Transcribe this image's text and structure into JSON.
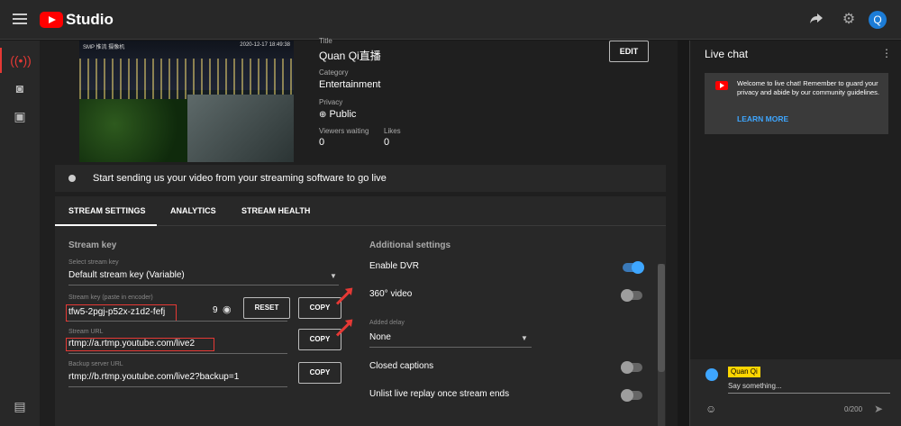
{
  "app": {
    "title": "Studio"
  },
  "header": {
    "avatar_letter": "Q",
    "share_icon": "share-icon",
    "settings_icon": "gear-icon"
  },
  "nav": {
    "items": [
      {
        "name": "live-icon",
        "glyph": "((•))"
      },
      {
        "name": "camera-icon",
        "glyph": "◙"
      },
      {
        "name": "calendar-icon",
        "glyph": "▣"
      },
      {
        "name": "feedback-icon",
        "glyph": "▤"
      }
    ]
  },
  "stream": {
    "thumb_stamp_left": "SMP 推流 摄像机",
    "thumb_stamp_right": "2020-12-17 18:49:38",
    "title_label": "Title",
    "title": "Quan Qi直播",
    "category_label": "Category",
    "category": "Entertainment",
    "privacy_label": "Privacy",
    "privacy": "Public",
    "viewers_label": "Viewers waiting",
    "viewers": "0",
    "likes_label": "Likes",
    "likes": "0",
    "edit_label": "EDIT",
    "status_text": "Start sending us your video from your streaming software to go live"
  },
  "tabs": [
    {
      "label": "STREAM SETTINGS",
      "active": true
    },
    {
      "label": "ANALYTICS",
      "active": false
    },
    {
      "label": "STREAM HEALTH",
      "active": false
    }
  ],
  "settings": {
    "stream_key_title": "Stream key",
    "select_key_label": "Select stream key",
    "select_key_value": "Default stream key (Variable)",
    "key_label": "Stream key (paste in encoder)",
    "key_value": "tfw5-2pgj-p52x-z1d2-fefj",
    "key_count": "9",
    "reset_label": "RESET",
    "copy_label": "COPY",
    "url_label": "Stream URL",
    "url_value": "rtmp://a.rtmp.youtube.com/live2",
    "backup_label": "Backup server URL",
    "backup_value": "rtmp://b.rtmp.youtube.com/live2?backup=1",
    "additional_title": "Additional settings",
    "dvr_label": "Enable DVR",
    "dvr_on": true,
    "video360_label": "360° video",
    "video360_on": false,
    "delay_label": "Added delay",
    "delay_value": "None",
    "captions_label": "Closed captions",
    "captions_on": false,
    "unlist_label": "Unlist live replay once stream ends",
    "unlist_on": false
  },
  "chat": {
    "title": "Live chat",
    "welcome": "Welcome to live chat! Remember to guard your privacy and abide by our community guidelines.",
    "learn_more": "LEARN MORE",
    "user_name": "Quan Qi",
    "placeholder": "Say something...",
    "counter": "0/200"
  },
  "colors": {
    "accent_red": "#e53935",
    "link_blue": "#3ea6ff",
    "badge_yellow": "#ffd600"
  }
}
